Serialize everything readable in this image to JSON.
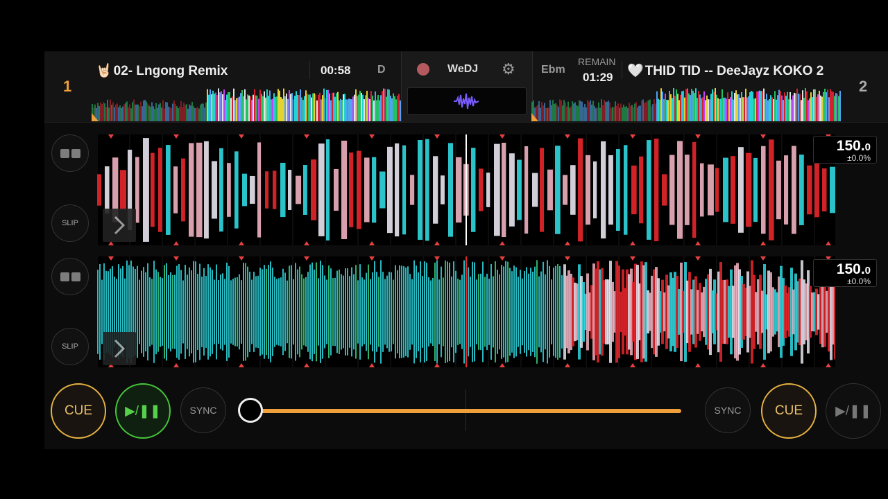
{
  "deck1": {
    "number": "1",
    "title": "02- Lngong Remix",
    "title_emoji": "🤘🏻",
    "elapsed": "00:58",
    "key": "D",
    "bpm": "150.",
    "bpm_decimal": "0",
    "pitch": "±0.0%",
    "slip_label": "SLIP",
    "cue_label": "CUE",
    "play_label": "▶/❚❚",
    "sync_label": "SYNC"
  },
  "deck2": {
    "number": "2",
    "title": "THID TID -- DeeJayz KOKO 2",
    "title_emoji": "🤍",
    "key": "Ebm",
    "remain_label": "REMAIN",
    "remain": "01:29",
    "bpm": "150.",
    "bpm_decimal": "0",
    "pitch": "±0.0%",
    "slip_label": "SLIP",
    "cue_label": "CUE",
    "play_label": "▶/❚❚",
    "sync_label": "SYNC"
  },
  "center": {
    "brand": "WeDJ",
    "icons": [
      "record-icon",
      "gear-icon",
      "waveform-icon"
    ]
  },
  "crossfader": {
    "value": 0.0
  },
  "colors": {
    "accent_orange": "#f0a03b",
    "cue_yellow": "#e6b341",
    "play_green": "#46c63b",
    "wave_cyan": "#2fd8e0",
    "wave_red": "#e8262b"
  }
}
